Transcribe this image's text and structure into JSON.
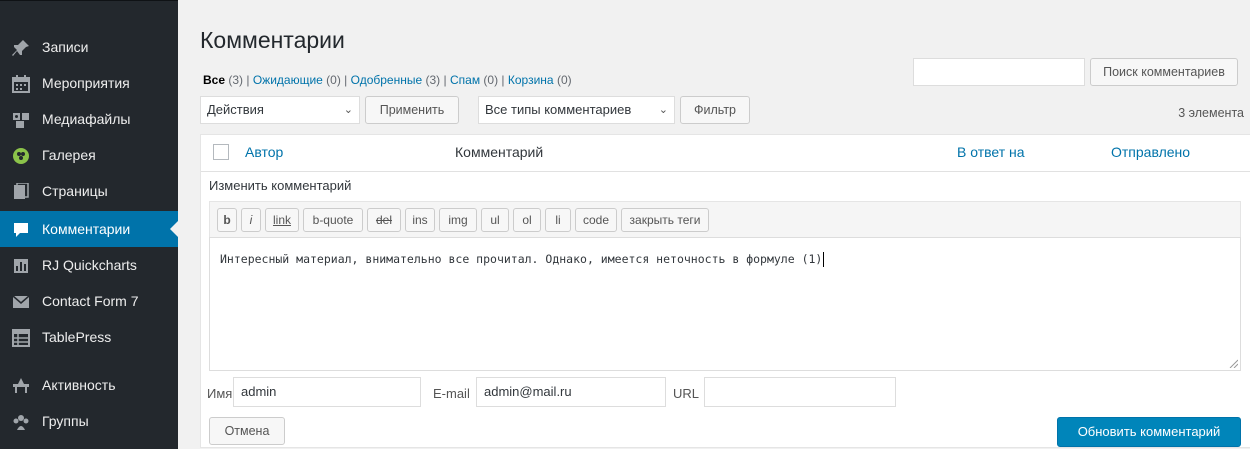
{
  "sidebar": {
    "items": [
      {
        "label": "Записи",
        "icon": "pin-icon"
      },
      {
        "label": "Мероприятия",
        "icon": "calendar-icon"
      },
      {
        "label": "Медиафайлы",
        "icon": "media-icon"
      },
      {
        "label": "Галерея",
        "icon": "gallery-icon"
      },
      {
        "label": "Страницы",
        "icon": "pages-icon"
      },
      {
        "label": "Комментарии",
        "icon": "comments-icon"
      },
      {
        "label": "RJ Quickcharts",
        "icon": "chart-icon"
      },
      {
        "label": "Contact Form 7",
        "icon": "mail-icon"
      },
      {
        "label": "TablePress",
        "icon": "table-icon"
      },
      {
        "label": "Активность",
        "icon": "activity-icon"
      },
      {
        "label": "Группы",
        "icon": "groups-icon"
      }
    ]
  },
  "page": {
    "title": "Комментарии",
    "filters": {
      "all": "Все",
      "all_count": "(3)",
      "pending": "Ожидающие",
      "pending_count": "(0)",
      "approved": "Одобренные",
      "approved_count": "(3)",
      "spam": "Спам",
      "spam_count": "(0)",
      "trash": "Корзина",
      "trash_count": "(0)"
    },
    "search_button": "Поиск комментариев",
    "bulk_action": "Действия",
    "apply_button": "Применить",
    "comment_type": "Все типы комментариев",
    "filter_button": "Фильтр",
    "items_count": "3 элемента"
  },
  "table": {
    "columns": {
      "author": "Автор",
      "comment": "Комментарий",
      "in_response_to": "В ответ на",
      "submitted": "Отправлено"
    }
  },
  "editor": {
    "title": "Изменить комментарий",
    "quicktags": [
      "b",
      "i",
      "link",
      "b-quote",
      "del",
      "ins",
      "img",
      "ul",
      "ol",
      "li",
      "code",
      "закрыть теги"
    ],
    "content": "Интересный материал, внимательно все прочитал. Однако, имеется неточность в формуле (1)",
    "name_label": "Имя",
    "name_value": "admin",
    "email_label": "E-mail",
    "email_value": "admin@mail.ru",
    "url_label": "URL",
    "url_value": "",
    "cancel_button": "Отмена",
    "update_button": "Обновить комментарий"
  },
  "colors": {
    "sidebar_bg": "#23282d",
    "accent": "#0073aa",
    "primary_button": "#0085ba"
  }
}
